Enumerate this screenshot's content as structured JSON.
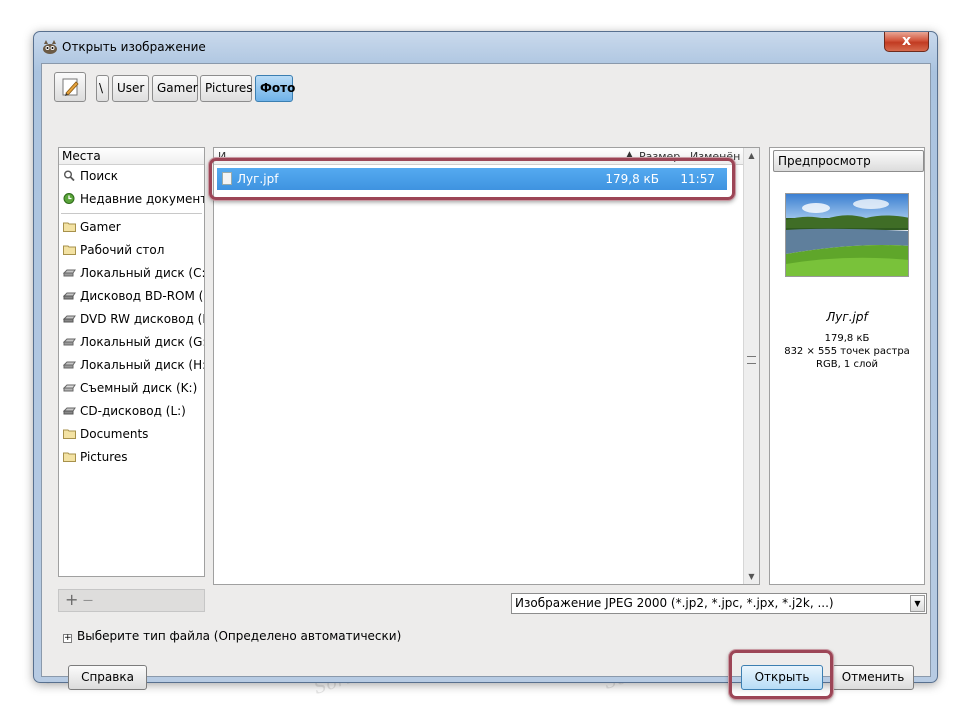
{
  "window": {
    "title": "Открыть изображение",
    "close_label": "x"
  },
  "path_bar": {
    "crumbs": [
      "\\",
      "User",
      "Gamer",
      "Pictures",
      "Фото"
    ],
    "active_index": 4
  },
  "places": {
    "header": "Места",
    "items": [
      {
        "label": "Поиск",
        "icon": "search-icon"
      },
      {
        "label": "Недавние документы",
        "icon": "recent-icon"
      },
      {
        "label": "Gamer",
        "icon": "folder-icon"
      },
      {
        "label": "Рабочий стол",
        "icon": "folder-icon"
      },
      {
        "label": "Локальный диск (C:)",
        "icon": "drive-icon"
      },
      {
        "label": "Дисковод BD-ROM (...",
        "icon": "optical-drive-icon"
      },
      {
        "label": "DVD RW дисковод (E:)",
        "icon": "optical-drive-icon"
      },
      {
        "label": "Локальный диск (G:)",
        "icon": "drive-icon"
      },
      {
        "label": "Локальный диск (H:)",
        "icon": "drive-icon"
      },
      {
        "label": "Съемный диск (K:)",
        "icon": "removable-drive-icon"
      },
      {
        "label": "CD-дисковод (L:)",
        "icon": "optical-drive-icon"
      },
      {
        "label": "Documents",
        "icon": "folder-icon"
      },
      {
        "label": "Pictures",
        "icon": "folder-icon"
      }
    ],
    "add_label": "+",
    "remove_label": "—"
  },
  "file_list": {
    "header_name": "И",
    "header_size": "Размер",
    "header_modified": "Изменён",
    "files": [
      {
        "name": "Луг.jpf",
        "size": "179,8 кБ",
        "modified": "11:57",
        "selected": true
      }
    ]
  },
  "preview": {
    "header": "Предпросмотр",
    "file_name": "Луг.jpf",
    "size": "179,8 кБ",
    "dimensions": "832 × 555 точек растра",
    "color_info": "RGB, 1 слой"
  },
  "filter": {
    "selected": "Изображение JPEG 2000 (*.jp2, *.jpc, *.jpx, *.j2k, ...)"
  },
  "file_type_expander": {
    "label": "Выберите тип файла (Определено автоматически)"
  },
  "buttons": {
    "help": "Справка",
    "open": "Открыть",
    "cancel": "Отменить"
  },
  "watermark_text": "Soringpcrepair.Com",
  "colors": {
    "selection": "#3f93e0",
    "highlight_border": "#9c4556",
    "active_crumb": "#6fb2e8"
  }
}
